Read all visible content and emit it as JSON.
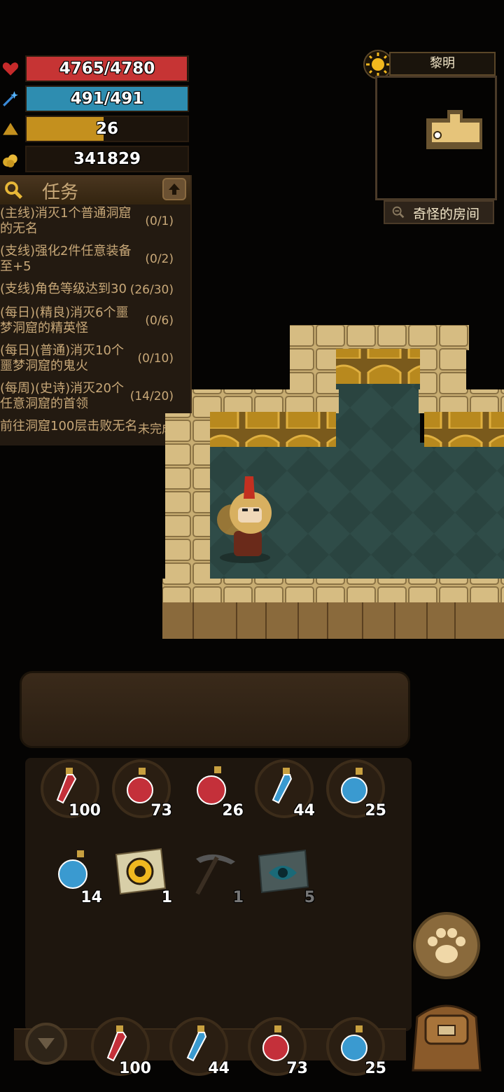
{
  "stats": {
    "hp": {
      "text": "4765/4780",
      "fraction": 0.997,
      "color": "#c63434",
      "icon": "heart-icon"
    },
    "mp": {
      "text": "491/491",
      "fraction": 1.0,
      "color": "#2e8db0",
      "icon": "magic-wand-icon"
    },
    "level": {
      "text": "26",
      "fraction": 0.48,
      "color": "#c4901e",
      "icon": "triangle-icon"
    },
    "gold": {
      "text": "341829",
      "icon": "gold-coins-icon"
    }
  },
  "quests": {
    "title": "任务",
    "items": [
      {
        "text": "(主线)消灭1个普通洞窟的无名",
        "progress": "(0/1)"
      },
      {
        "text": "(支线)强化2件任意装备至+5",
        "progress": "(0/2)"
      },
      {
        "text": "(支线)角色等级达到30",
        "progress": "(26/30)"
      },
      {
        "text": "(每日)(精良)消灭6个噩梦洞窟的精英怪",
        "progress": "(0/6)"
      },
      {
        "text": "(每日)(普通)消灭10个噩梦洞窟的鬼火",
        "progress": "(0/10)"
      },
      {
        "text": "(每周)(史诗)消灭20个任意洞窟的首领",
        "progress": "(14/20)"
      },
      {
        "text": "前往洞窟100层击败无名",
        "progress": "未完成"
      }
    ]
  },
  "minimap": {
    "time_label": "黎明",
    "location": "奇怪的房间"
  },
  "inventory": [
    {
      "name": "red-potion-small",
      "count": "100",
      "color": "#c4303a"
    },
    {
      "name": "red-potion-medium",
      "count": "73",
      "color": "#c4303a"
    },
    {
      "name": "red-potion-large",
      "count": "26",
      "color": "#c4303a"
    },
    {
      "name": "blue-potion-small",
      "count": "44",
      "color": "#3a9ad0"
    },
    {
      "name": "blue-potion-medium",
      "count": "25",
      "color": "#3a9ad0"
    },
    {
      "name": "blue-potion-large",
      "count": "14",
      "color": "#3a9ad0"
    },
    {
      "name": "scroll-teleport",
      "count": "1"
    },
    {
      "name": "pickaxe",
      "count": "1"
    },
    {
      "name": "scroll-eye",
      "count": "5"
    }
  ],
  "quickbar": [
    {
      "name": "red-potion-small",
      "count": "100",
      "color": "#c4303a"
    },
    {
      "name": "blue-potion-small",
      "count": "44",
      "color": "#3a9ad0"
    },
    {
      "name": "red-potion-medium",
      "count": "73",
      "color": "#c4303a"
    },
    {
      "name": "blue-potion-medium",
      "count": "25",
      "color": "#3a9ad0"
    }
  ]
}
